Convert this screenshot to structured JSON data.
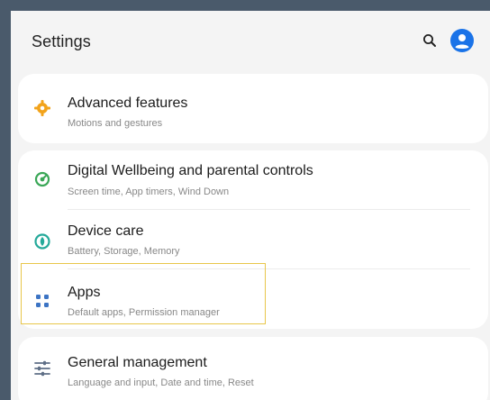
{
  "header": {
    "title": "Settings"
  },
  "icons": {
    "search": "search-icon",
    "account": "account-icon",
    "advanced": "advanced-features-icon",
    "wellbeing": "digital-wellbeing-icon",
    "device_care": "device-care-icon",
    "apps": "apps-icon",
    "general": "general-management-icon"
  },
  "colors": {
    "accent_blue": "#1a73e8",
    "advanced_orange": "#f2a31b",
    "wellbeing_green": "#3aa757",
    "device_care_teal": "#25a99a",
    "apps_blue": "#3c74c4",
    "general_gray": "#5f6f86",
    "highlight_border": "#e8c64a"
  },
  "items": [
    {
      "label": "Advanced features",
      "subtitle": "Motions and gestures"
    },
    {
      "label": "Digital Wellbeing and parental controls",
      "subtitle": "Screen time, App timers, Wind Down"
    },
    {
      "label": "Device care",
      "subtitle": "Battery, Storage, Memory"
    },
    {
      "label": "Apps",
      "subtitle": "Default apps, Permission manager"
    },
    {
      "label": "General management",
      "subtitle": "Language and input, Date and time, Reset"
    }
  ]
}
